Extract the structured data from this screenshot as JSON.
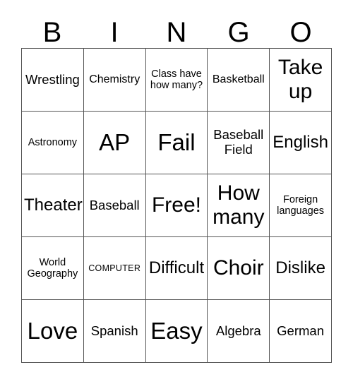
{
  "header": {
    "letters": [
      "B",
      "I",
      "N",
      "G",
      "O"
    ]
  },
  "grid": {
    "columns": 5,
    "rows": 5,
    "border_color": "#555555",
    "background_color": "#ffffff",
    "text_color": "#000000",
    "cells": [
      {
        "text": "Wrestling",
        "size": "lg"
      },
      {
        "text": "Chemistry",
        "size": "md"
      },
      {
        "text": "Class have how many?",
        "size": "sm"
      },
      {
        "text": "Basketball",
        "size": "md"
      },
      {
        "text": "Take up",
        "size": "2xl"
      },
      {
        "text": "Astronomy",
        "size": "sm"
      },
      {
        "text": "AP",
        "size": "3xl"
      },
      {
        "text": "Fail",
        "size": "3xl"
      },
      {
        "text": "Baseball Field",
        "size": "lg"
      },
      {
        "text": "English",
        "size": "xl"
      },
      {
        "text": "Theater",
        "size": "xl"
      },
      {
        "text": "Baseball",
        "size": "lg"
      },
      {
        "text": "Free!",
        "size": "2xl"
      },
      {
        "text": "How many",
        "size": "2xl"
      },
      {
        "text": "Foreign languages",
        "size": "sm"
      },
      {
        "text": "World Geography",
        "size": "sm"
      },
      {
        "text": "COMPUTER",
        "size": "xs"
      },
      {
        "text": "Difficult",
        "size": "xl"
      },
      {
        "text": "Choir",
        "size": "2xl"
      },
      {
        "text": "Dislike",
        "size": "xl"
      },
      {
        "text": "Love",
        "size": "3xl"
      },
      {
        "text": "Spanish",
        "size": "lg"
      },
      {
        "text": "Easy",
        "size": "3xl"
      },
      {
        "text": "Algebra",
        "size": "lg"
      },
      {
        "text": "German",
        "size": "lg"
      }
    ]
  }
}
